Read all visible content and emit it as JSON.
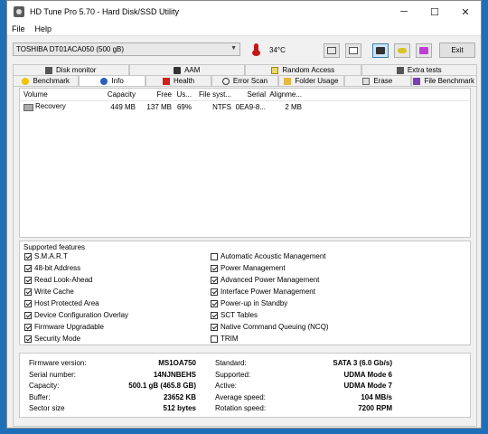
{
  "window": {
    "title": "HD Tune Pro 5.70 - Hard Disk/SSD Utility",
    "minimize": "─",
    "maximize": "☐",
    "close": "✕"
  },
  "menu": {
    "file": "File",
    "help": "Help"
  },
  "toolbar": {
    "drive": "TOSHIBA DT01ACA050 (500 gB)",
    "temperature": "34°C",
    "exit_label": "Exit"
  },
  "tabs": {
    "row1": [
      "Disk monitor",
      "AAM",
      "Random Access",
      "Extra tests"
    ],
    "row2": [
      "Benchmark",
      "Info",
      "Health",
      "Error Scan",
      "Folder Usage",
      "Erase",
      "File Benchmark"
    ]
  },
  "volumes": {
    "headers": [
      "Volume",
      "Capacity",
      "Free",
      "Us...",
      "File syst...",
      "Serial",
      "Alignme..."
    ],
    "rows": [
      [
        "Recovery",
        "449 MB",
        "137 MB",
        "69%",
        "NTFS",
        "0EA9-8...",
        "2 MB"
      ]
    ]
  },
  "features": {
    "legend": "Supported features",
    "left": [
      {
        "label": "S.M.A.R.T",
        "checked": true
      },
      {
        "label": "48-bit Address",
        "checked": true
      },
      {
        "label": "Read Look-Ahead",
        "checked": true
      },
      {
        "label": "Write Cache",
        "checked": true
      },
      {
        "label": "Host Protected Area",
        "checked": true
      },
      {
        "label": "Device Configuration Overlay",
        "checked": true
      },
      {
        "label": "Firmware Upgradable",
        "checked": true
      },
      {
        "label": "Security Mode",
        "checked": true
      }
    ],
    "right": [
      {
        "label": "Automatic Acoustic Management",
        "checked": false
      },
      {
        "label": "Power Management",
        "checked": true
      },
      {
        "label": "Advanced Power Management",
        "checked": true
      },
      {
        "label": "Interface Power Management",
        "checked": true
      },
      {
        "label": "Power-up in Standby",
        "checked": true
      },
      {
        "label": "SCT Tables",
        "checked": true
      },
      {
        "label": "Native Command Queuing (NCQ)",
        "checked": true
      },
      {
        "label": "TRIM",
        "checked": false
      }
    ]
  },
  "info": {
    "left": [
      {
        "label": "Firmware version:",
        "value": "MS1OA750"
      },
      {
        "label": "Serial number:",
        "value": "14NJNBEHS"
      },
      {
        "label": "Capacity:",
        "value": "500.1 gB (465.8 GB)"
      },
      {
        "label": "Buffer:",
        "value": "23652 KB"
      },
      {
        "label": "Sector size",
        "value": "512 bytes"
      }
    ],
    "right": [
      {
        "label": "Standard:",
        "value": "SATA 3 (6.0 Gb/s)"
      },
      {
        "label": "Supported:",
        "value": "UDMA Mode 6"
      },
      {
        "label": "Active:",
        "value": "UDMA Mode 7"
      },
      {
        "label": "Average speed:",
        "value": "104 MB/s"
      },
      {
        "label": "Rotation speed:",
        "value": "7200 RPM"
      }
    ]
  }
}
